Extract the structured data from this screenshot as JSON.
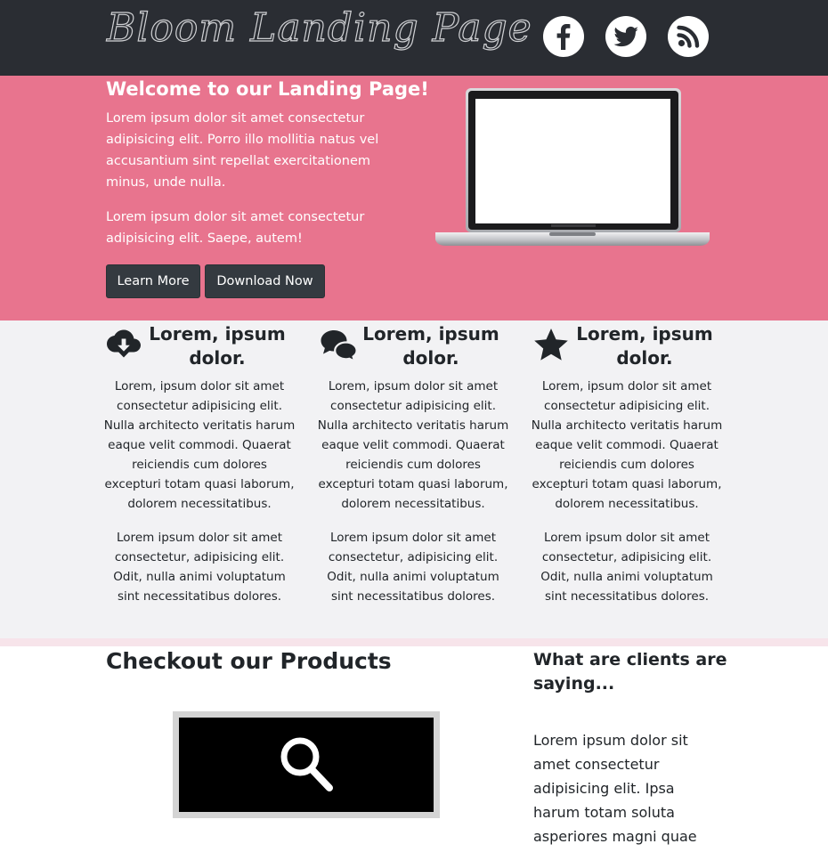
{
  "header": {
    "logo_text": "Bloom Landing Page",
    "social": [
      {
        "name": "facebook",
        "icon": "facebook-icon"
      },
      {
        "name": "twitter",
        "icon": "twitter-icon"
      },
      {
        "name": "rss",
        "icon": "rss-icon"
      }
    ]
  },
  "hero": {
    "title": "Welcome to our Landing Page!",
    "paragraph1": "Lorem ipsum dolor sit amet consectetur adipisicing elit. Porro illo mollitia natus vel accusantium sint repellat exercitationem minus, unde nulla.",
    "paragraph2": "Lorem ipsum dolor sit amet consectetur adipisicing elit. Saepe, autem!",
    "learn_more_label": "Learn More",
    "download_label": "Download Now",
    "image": "laptop"
  },
  "features": [
    {
      "icon": "cloud-download-icon",
      "title": "Lorem, ipsum dolor.",
      "p1": "Lorem, ipsum dolor sit amet consectetur adipisicing elit. Nulla architecto veritatis harum eaque velit commodi. Quaerat reiciendis cum dolores excepturi totam quasi laborum, dolorem necessitatibus.",
      "p2": "Lorem ipsum dolor sit amet consectetur, adipisicing elit. Odit, nulla animi voluptatum sint necessitatibus dolores."
    },
    {
      "icon": "comments-icon",
      "title": "Lorem, ipsum dolor.",
      "p1": "Lorem, ipsum dolor sit amet consectetur adipisicing elit. Nulla architecto veritatis harum eaque velit commodi. Quaerat reiciendis cum dolores excepturi totam quasi laborum, dolorem necessitatibus.",
      "p2": "Lorem ipsum dolor sit amet consectetur, adipisicing elit. Odit, nulla animi voluptatum sint necessitatibus dolores."
    },
    {
      "icon": "star-icon",
      "title": "Lorem, ipsum dolor.",
      "p1": "Lorem, ipsum dolor sit amet consectetur adipisicing elit. Nulla architecto veritatis harum eaque velit commodi. Quaerat reiciendis cum dolores excepturi totam quasi laborum, dolorem necessitatibus.",
      "p2": "Lorem ipsum dolor sit amet consectetur, adipisicing elit. Odit, nulla animi voluptatum sint necessitatibus dolores."
    }
  ],
  "products": {
    "title": "Checkout our Products",
    "icon": "search-icon"
  },
  "clients": {
    "title": "What are clients are saying...",
    "text": "Lorem ipsum dolor sit amet consectetur adipisicing elit. Ipsa harum totam soluta asperiores magni quae"
  },
  "colors": {
    "header_bg": "#2a2d33",
    "hero_bg": "#e8748e",
    "features_bg": "#f2f2f4",
    "button_bg": "#343a40"
  }
}
